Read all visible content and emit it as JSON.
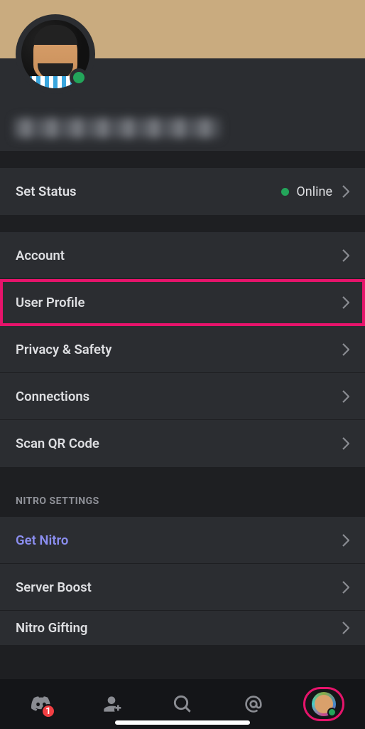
{
  "status_row": {
    "label": "Set Status",
    "value": "Online"
  },
  "settings_rows": [
    {
      "label": "Account"
    },
    {
      "label": "User Profile",
      "highlighted": true
    },
    {
      "label": "Privacy & Safety"
    },
    {
      "label": "Connections"
    },
    {
      "label": "Scan QR Code"
    }
  ],
  "nitro": {
    "section_title": "NITRO SETTINGS",
    "rows": [
      {
        "label": "Get Nitro",
        "accent": true
      },
      {
        "label": "Server Boost"
      },
      {
        "label": "Nitro Gifting",
        "partial": true
      }
    ]
  },
  "tabbar": {
    "badge_count": "1"
  }
}
